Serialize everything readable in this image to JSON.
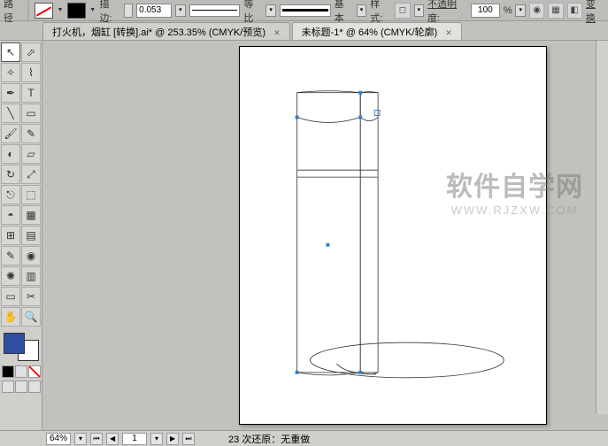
{
  "topbar": {
    "path_label": "路径",
    "stroke_label": "描边:",
    "stroke_weight": "0.053",
    "ratio_label": "等比",
    "basic_label": "基本",
    "style_label": "样式:",
    "opacity_label": "不透明度:",
    "opacity_value": "100",
    "opacity_suffix": "%",
    "transform_label": "变换"
  },
  "tabs": {
    "inactive": "打火机，烟缸  [转换].ai* @ 253.35% (CMYK/预览)",
    "active": "未标题-1* @ 64%  (CMYK/轮廓)"
  },
  "status": {
    "zoom": "64%",
    "page": "1",
    "history": "23 次还原：无重做"
  },
  "watermark": {
    "line1": "软件自学网",
    "line2": "WWW.RJZXW.COM"
  },
  "tools": [
    "▲",
    "▲",
    "✒",
    "T",
    "╲",
    "▭",
    "🖌",
    "✎",
    "◐",
    "▦",
    "◉",
    "▤",
    "⊞",
    "✂",
    "⤢",
    "↻",
    "〰",
    "⬚",
    "⎍",
    "⌷",
    "/",
    "Q",
    "✥",
    "⬜",
    "✋",
    "🔍",
    "▭",
    "▭",
    "◧",
    "◧",
    "▭",
    "◫"
  ]
}
